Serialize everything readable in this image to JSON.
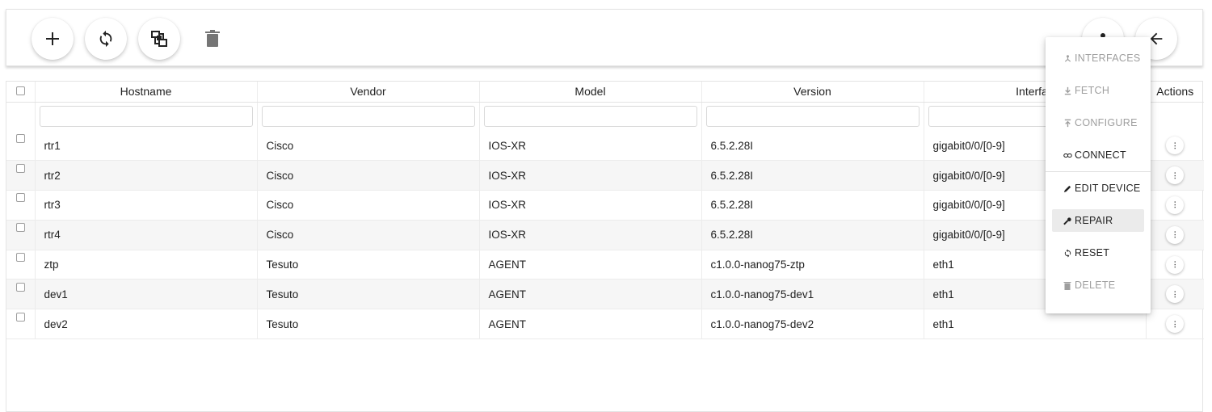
{
  "toolbar": {
    "buttons": [
      {
        "name": "add-button",
        "icon": "plus-icon"
      },
      {
        "name": "refresh-button",
        "icon": "sync-icon"
      },
      {
        "name": "topology-button",
        "icon": "hub-icon"
      },
      {
        "name": "delete-button",
        "icon": "trash-icon"
      },
      {
        "name": "location-button",
        "icon": "pin-icon"
      },
      {
        "name": "back-button",
        "icon": "arrow-left-icon"
      }
    ]
  },
  "table": {
    "columns": [
      "Hostname",
      "Vendor",
      "Model",
      "Version",
      "Interfac",
      "Actions"
    ],
    "filter_placeholders": [
      "",
      "",
      "",
      "",
      ""
    ],
    "rows": [
      {
        "hostname": "rtr1",
        "vendor": "Cisco",
        "model": "IOS-XR",
        "version": "6.5.2.28I",
        "interfaces": "gigabit0/0/[0-9]"
      },
      {
        "hostname": "rtr2",
        "vendor": "Cisco",
        "model": "IOS-XR",
        "version": "6.5.2.28I",
        "interfaces": "gigabit0/0/[0-9]"
      },
      {
        "hostname": "rtr3",
        "vendor": "Cisco",
        "model": "IOS-XR",
        "version": "6.5.2.28I",
        "interfaces": "gigabit0/0/[0-9]"
      },
      {
        "hostname": "rtr4",
        "vendor": "Cisco",
        "model": "IOS-XR",
        "version": "6.5.2.28I",
        "interfaces": "gigabit0/0/[0-9]"
      },
      {
        "hostname": "ztp",
        "vendor": "Tesuto",
        "model": "AGENT",
        "version": "c1.0.0-nanog75-ztp",
        "interfaces": "eth1"
      },
      {
        "hostname": "dev1",
        "vendor": "Tesuto",
        "model": "AGENT",
        "version": "c1.0.0-nanog75-dev1",
        "interfaces": "eth1"
      },
      {
        "hostname": "dev2",
        "vendor": "Tesuto",
        "model": "AGENT",
        "version": "c1.0.0-nanog75-dev2",
        "interfaces": "eth1"
      }
    ]
  },
  "menu": {
    "items": [
      {
        "label": "INTERFACES",
        "icon": "interfaces-icon",
        "state": "disabled"
      },
      {
        "label": "FETCH",
        "icon": "download-icon",
        "state": "disabled"
      },
      {
        "label": "CONFIGURE",
        "icon": "upload-icon",
        "state": "disabled"
      },
      {
        "label": "CONNECT",
        "icon": "link-icon",
        "state": "enabled"
      },
      {
        "label": "EDIT DEVICE",
        "icon": "pencil-icon",
        "state": "enabled"
      },
      {
        "label": "REPAIR",
        "icon": "wrench-icon",
        "state": "selected"
      },
      {
        "label": "RESET",
        "icon": "reset-icon",
        "state": "enabled"
      },
      {
        "label": "DELETE",
        "icon": "trash-icon",
        "state": "disabled"
      }
    ]
  },
  "colors": {
    "text": "#212121",
    "disabled": "#9e9e9e",
    "icon_grey": "#757575",
    "row_stripe": "#f6f6f6"
  }
}
